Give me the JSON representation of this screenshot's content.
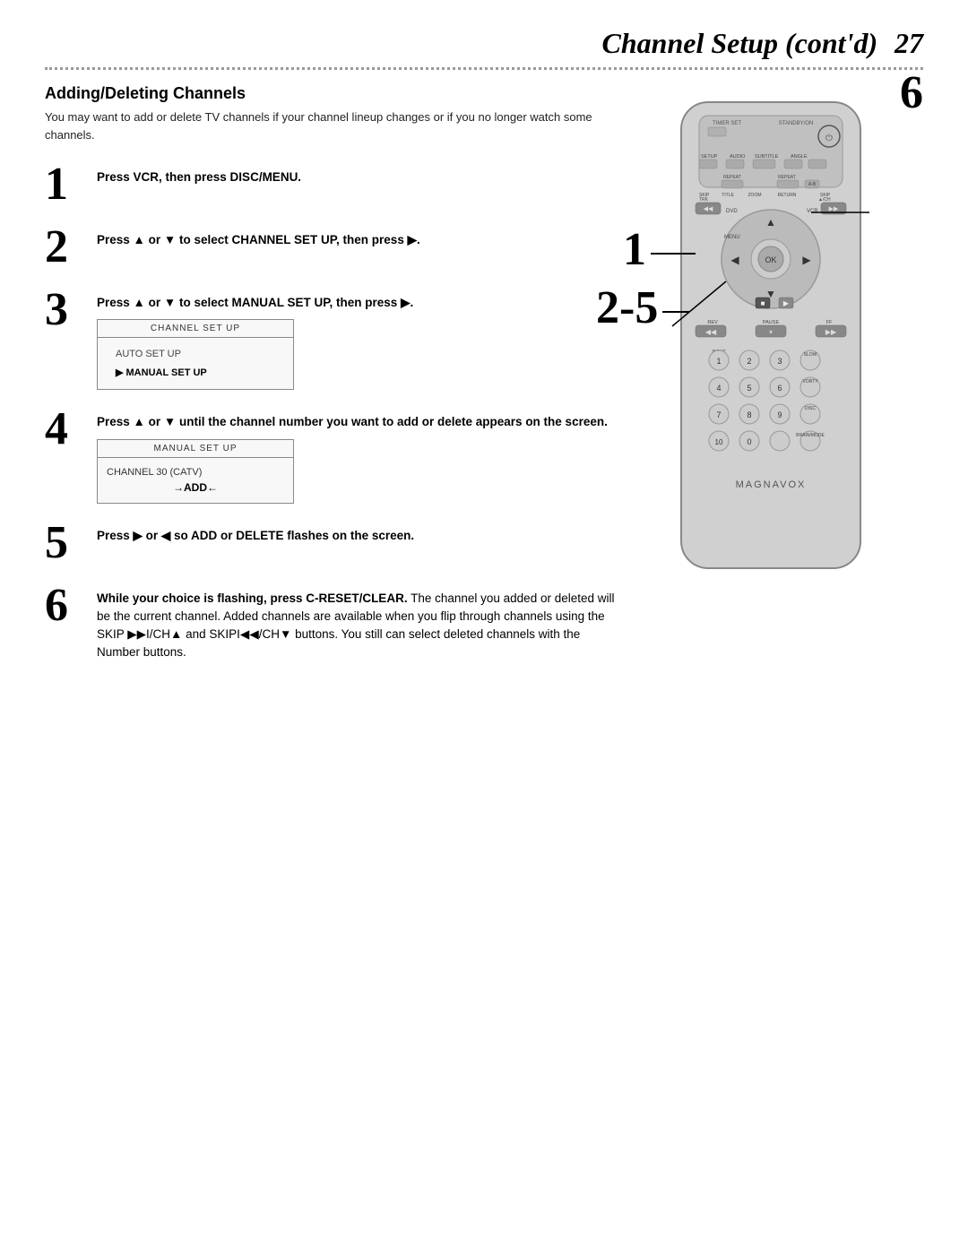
{
  "header": {
    "title": "Channel Setup (cont'd)",
    "page_number": "27"
  },
  "dotted_line": true,
  "section": {
    "title": "Adding/Deleting Channels",
    "subtitle": "You may want to add or delete TV channels if your channel lineup changes or if you no longer watch some channels."
  },
  "steps": [
    {
      "number": "1",
      "text": "Press VCR, then press DISC/MENU.",
      "has_menu": false
    },
    {
      "number": "2",
      "text": "Press ▲ or ▼ to select CHANNEL SET UP, then press ▶.",
      "has_menu": false
    },
    {
      "number": "3",
      "text": "Press ▲ or ▼ to select MANUAL SET UP, then press ▶.",
      "has_menu": true,
      "menu": {
        "title": "CHANNEL SET UP",
        "items": [
          {
            "label": "AUTO SET UP",
            "selected": false
          },
          {
            "label": "MANUAL SET UP",
            "selected": true
          }
        ]
      }
    },
    {
      "number": "4",
      "text": "Press ▲ or ▼ until the channel number you want to add or delete appears on the screen.",
      "has_menu": true,
      "menu": {
        "title": "MANUAL SET UP",
        "rows": [
          "CHANNEL  30  (CATV)",
          "→ADD←"
        ]
      }
    },
    {
      "number": "5",
      "text": "Press ▶ or ◀ so ADD or DELETE flashes on the screen.",
      "has_menu": false
    },
    {
      "number": "6",
      "text_bold": "While your choice is flashing, press C-RESET/CLEAR.",
      "text_normal": " The channel you added or deleted will be the current channel. Added channels are available when you flip through channels using the SKIP ▶▶I/CH▲ and SKIPI◀◀/CH▼ buttons. You still can select deleted channels with the Number buttons.",
      "has_menu": false
    }
  ],
  "remote": {
    "brand": "MAGNAVOX",
    "label_6": "6",
    "label_1": "1",
    "label_25": "2-5"
  }
}
